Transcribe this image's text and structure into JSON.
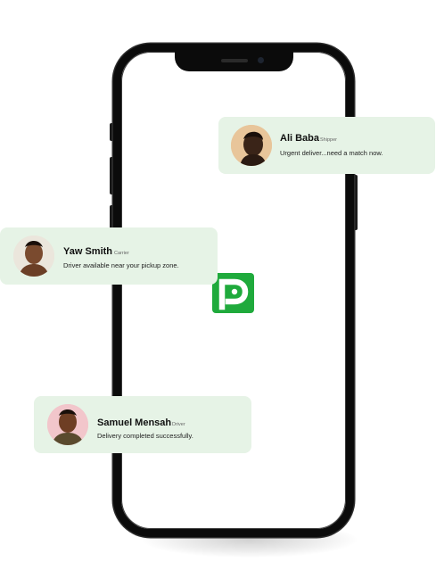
{
  "app": {
    "logo_letter": "P",
    "brand_color": "#1faa3c"
  },
  "notifications": [
    {
      "name": "Ali Baba",
      "role": "Shipper",
      "message": "Urgent deliver...need a match now."
    },
    {
      "name": "Yaw Smith",
      "role": "Carrier",
      "message": "Driver available near your pickup zone."
    },
    {
      "name": "Samuel Mensah",
      "role": "Driver",
      "message": "Delivery completed successfully."
    }
  ]
}
